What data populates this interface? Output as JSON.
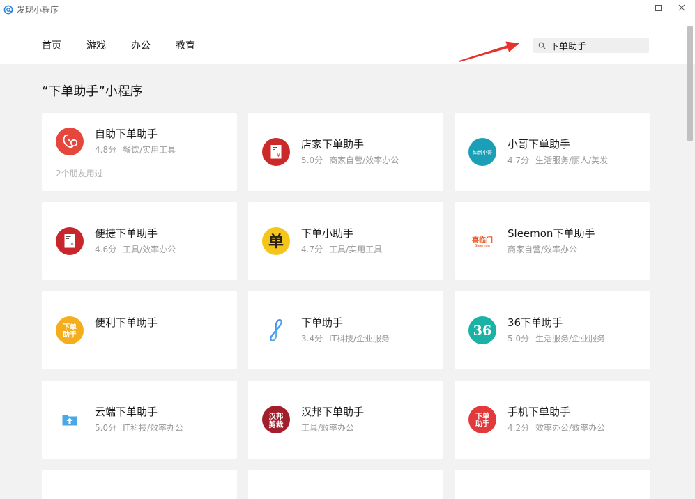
{
  "window": {
    "title": "发现小程序",
    "logo_icon": "mini-program-logo-icon",
    "controls": [
      "minimize-icon",
      "maximize-icon",
      "close-icon"
    ]
  },
  "nav": {
    "tabs": [
      {
        "label": "首页"
      },
      {
        "label": "游戏"
      },
      {
        "label": "办公"
      },
      {
        "label": "教育"
      }
    ]
  },
  "search": {
    "value": "下单助手",
    "icon": "search-icon"
  },
  "section": {
    "title": "“下单助手”小程序"
  },
  "results": [
    {
      "name": "自助下单助手",
      "rating": "4.8分",
      "category": "餐饮/实用工具",
      "friends": "2个朋友用过",
      "icon": "stethoscope-icon",
      "icon_color": "#e5473d"
    },
    {
      "name": "店家下单助手",
      "rating": "5.0分",
      "category": "商家自营/效率办公",
      "icon": "receipt-icon",
      "icon_color": "#cc2a2a",
      "icon_text": [
        "¥"
      ]
    },
    {
      "name": "小哥下单助手",
      "rating": "4.7分",
      "category": "生活服务/丽人/美发",
      "icon": "rushin-logo-icon",
      "icon_color": "#1a9fb7",
      "icon_text": [
        "如新小哥"
      ]
    },
    {
      "name": "便捷下单助手",
      "rating": "4.6分",
      "category": "工具/效率办公",
      "icon": "receipt-icon",
      "icon_color": "#c9252c",
      "icon_text": [
        "¥"
      ]
    },
    {
      "name": "下单小助手",
      "rating": "4.7分",
      "category": "工具/实用工具",
      "icon": "dan-character-icon",
      "icon_color": "#f5c51a",
      "icon_text": [
        "单"
      ]
    },
    {
      "name": "Sleemon下单助手",
      "category": "商家自营/效率办公",
      "icon": "sleemon-logo-icon",
      "icon_color": "#e4561f",
      "icon_text": [
        "喜临门",
        "Sleemon"
      ]
    },
    {
      "name": "便利下单助手",
      "icon": "xiadan-zhushou-logo-icon",
      "icon_color": "#f6ad1b",
      "icon_text": [
        "下单",
        "助手"
      ]
    },
    {
      "name": "下单助手",
      "rating": "3.4分",
      "category": "IT科技/企业服务",
      "icon": "infinity-icon",
      "icon_color": "#7b4cf5"
    },
    {
      "name": "36下单助手",
      "rating": "5.0分",
      "category": "生活服务/企业服务",
      "icon": "36-logo-icon",
      "icon_color": "#1bb2a6",
      "icon_text": [
        "36"
      ]
    },
    {
      "name": "云端下单助手",
      "rating": "5.0分",
      "category": "IT科技/效率办公",
      "icon": "cloud-upload-box-icon",
      "icon_color": "#4aa8e6"
    },
    {
      "name": "汉邦下单助手",
      "category": "工具/效率办公",
      "icon": "hanbang-logo-icon",
      "icon_color": "#a11f2b",
      "icon_text": [
        "汉邦",
        "剪裁"
      ]
    },
    {
      "name": "手机下单助手",
      "rating": "4.2分",
      "category": "效率办公/效率办公",
      "icon": "xiadan-zhushou-logo-icon",
      "icon_color": "#e23a3c",
      "icon_text": [
        "下单",
        "助手"
      ]
    }
  ],
  "annotation": {
    "arrow_color": "#e5322d"
  },
  "theme": {
    "page_background": "#f2f2f2",
    "header_background": "#ffffff",
    "card_background": "#ffffff"
  }
}
